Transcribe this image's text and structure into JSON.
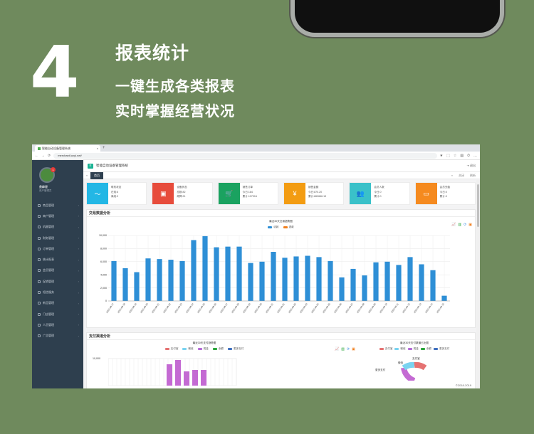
{
  "hero": {
    "number": "4",
    "title": "报表统计",
    "line1": "一键生成各类报表",
    "line2": "实时掌握经营状况"
  },
  "browser": {
    "tab_title": "智能自动设备管理系统",
    "url": "merchant.luxyi.net/"
  },
  "app": {
    "title": "智能自动设备管理系统",
    "exit_label": "退出",
    "home_tab": "首页",
    "close_label": "关闭",
    "refresh_label": "刷新"
  },
  "user": {
    "name": "鼎峰健",
    "role": "商户管理员",
    "badge": "1"
  },
  "sidebar": {
    "items": [
      {
        "label": "商品管理"
      },
      {
        "label": "商户管理"
      },
      {
        "label": "机器管理"
      },
      {
        "label": "财务管理"
      },
      {
        "label": "订单管理"
      },
      {
        "label": "统计报表"
      },
      {
        "label": "会员管理"
      },
      {
        "label": "促销管理"
      },
      {
        "label": "短信服务"
      },
      {
        "label": "新品管理"
      },
      {
        "label": "门店管理"
      },
      {
        "label": "人员管理"
      },
      {
        "label": "广告管理"
      }
    ]
  },
  "stats": [
    {
      "title": "联机状态",
      "l1": "在线:6",
      "l2": "离线:9",
      "color": "#23b7e5",
      "icon": "pulse-icon"
    },
    {
      "title": "设备状态",
      "l1": "总数:82",
      "l2": "故障:21",
      "color": "#e74c3c",
      "icon": "device-icon"
    },
    {
      "title": "销售订单",
      "l1": "今日:184",
      "l2": "累计:197316",
      "color": "#1aa260",
      "icon": "cart-icon"
    },
    {
      "title": "销售金额",
      "l1": "今日:870.20",
      "l2": "累计:860666.13",
      "color": "#f39c12",
      "icon": "yen-icon"
    },
    {
      "title": "会员人数",
      "l1": "今日:0",
      "l2": "累计:0",
      "color": "#3ac1c9",
      "icon": "users-icon"
    },
    {
      "title": "会员充值",
      "l1": "今日:0",
      "l2": "累计:0",
      "color": "#f58a1f",
      "icon": "money-icon"
    }
  ],
  "trade_panel": {
    "heading": "交易数据分析",
    "chart_title": "最近30天交易趋势图",
    "legend": [
      {
        "label": "收款",
        "color": "#2e8fd6"
      },
      {
        "label": "退款",
        "color": "#f07f1e"
      }
    ]
  },
  "pay_panel": {
    "heading": "支付渠道分析",
    "chart_title": "最近30天支付趋势图",
    "pie_title": "最近30天支付渠道占比图",
    "legend": [
      {
        "label": "支付宝",
        "color": "#e57272"
      },
      {
        "label": "微信",
        "color": "#7ad3f0"
      },
      {
        "label": "现金",
        "color": "#b36ad6"
      },
      {
        "label": "余额",
        "color": "#2aa53b"
      },
      {
        "label": "更多支付",
        "color": "#3f6fbf"
      }
    ],
    "pie_labels": [
      "支付宝",
      "微信",
      "更多支付"
    ],
    "y_max_label": "10,000"
  },
  "footer": "©2018-2019",
  "chart_data": {
    "type": "bar",
    "title": "最近30天交易趋势图",
    "categories": [
      "2022-08-17",
      "2022-08-18",
      "2022-08-19",
      "2022-08-20",
      "2022-08-21",
      "2022-08-22",
      "2022-08-23",
      "2022-08-24",
      "2022-08-25",
      "2022-08-26",
      "2022-08-27",
      "2022-08-28",
      "2022-08-29",
      "2022-08-30",
      "2022-08-31",
      "2022-09-01",
      "2022-09-02",
      "2022-09-03",
      "2022-09-04",
      "2022-09-05",
      "2022-09-06",
      "2022-09-07",
      "2022-09-08",
      "2022-09-09",
      "2022-09-10",
      "2022-09-11",
      "2022-09-12",
      "2022-09-13",
      "2022-09-14",
      "2022-09-15"
    ],
    "series": [
      {
        "name": "收款",
        "values": [
          6100,
          5000,
          4400,
          6500,
          6400,
          6300,
          6100,
          9300,
          9900,
          8200,
          8300,
          8300,
          5800,
          6000,
          7500,
          6600,
          6800,
          6900,
          6700,
          6100,
          3600,
          4900,
          3900,
          5900,
          6000,
          5500,
          6700,
          5600,
          4700,
          800
        ]
      },
      {
        "name": "退款",
        "values": [
          0,
          0,
          0,
          0,
          0,
          0,
          0,
          0,
          0,
          0,
          0,
          0,
          0,
          0,
          0,
          0,
          0,
          0,
          0,
          0,
          0,
          0,
          0,
          0,
          0,
          0,
          0,
          0,
          0,
          0
        ]
      }
    ],
    "ylim": [
      0,
      10000
    ],
    "yticks": [
      "0",
      "2,000",
      "4,000",
      "6,000",
      "8,000",
      "10,000"
    ],
    "grid": true,
    "legend_position": "top-center",
    "colors": {
      "receipt": "#2e8fd6",
      "refund": "#f07f1e"
    }
  }
}
